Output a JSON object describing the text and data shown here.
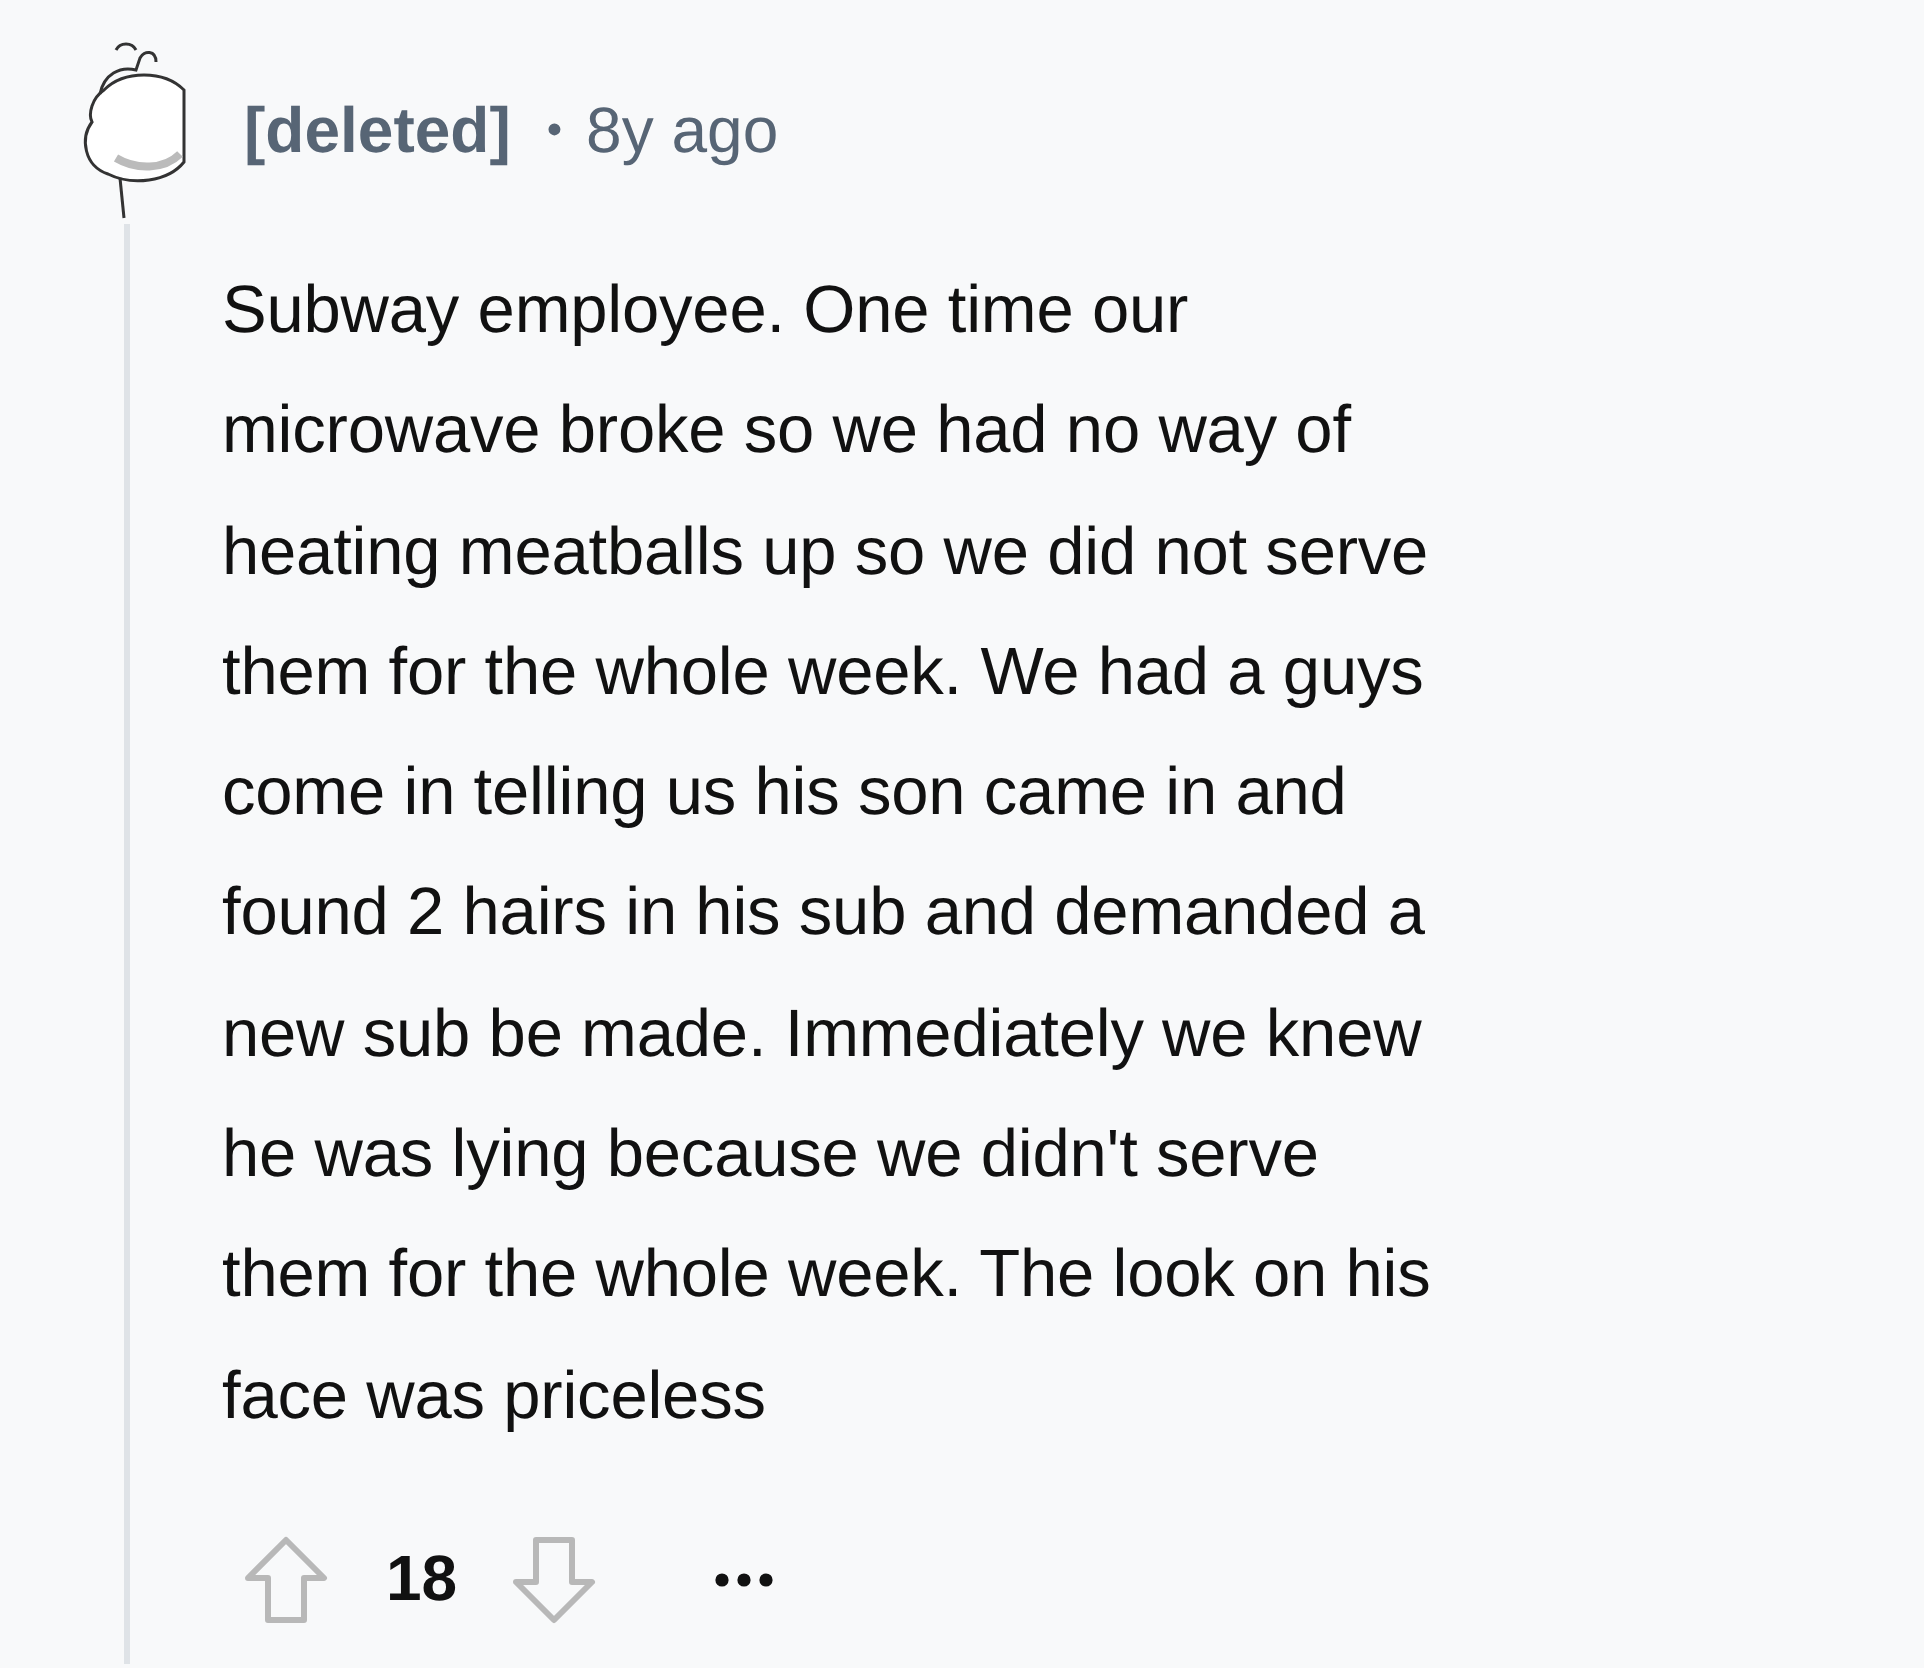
{
  "comment": {
    "author": "[deleted]",
    "separator": "•",
    "age": "8y ago",
    "body_lines": [
      "Subway employee. One time our",
      "microwave broke so we had no way of",
      "heating meatballs up so we did not serve",
      "them for the whole week. We had a guys",
      "come in telling us his son came in and",
      "found 2 hairs in his sub and demanded a",
      "new sub be made. Immediately we knew",
      "he was lying because we didn't serve",
      "them for the whole week. The look on his",
      "face was priceless"
    ],
    "score": "18"
  }
}
